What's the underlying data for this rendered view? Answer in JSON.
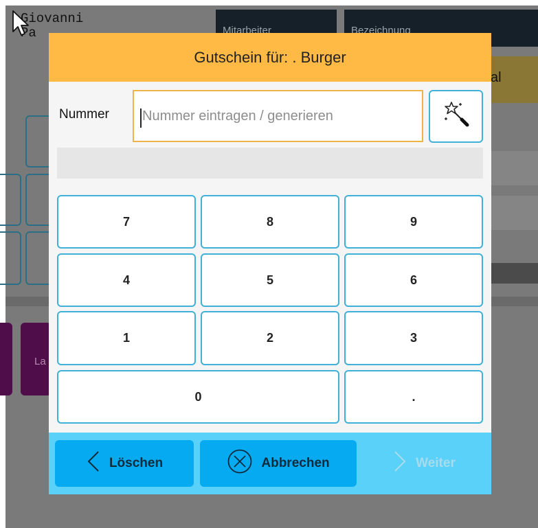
{
  "background": {
    "user_line1": "Giovanni",
    "user_line2": "Pa",
    "header_col1": "Mitarbeiter",
    "header_col2": "Bezeichnung",
    "gold_button_fragment": "al",
    "purple_button_fragment": "La"
  },
  "dialog": {
    "title": "Gutschein für: . Burger",
    "number_label": "Nummer",
    "number_placeholder": "Nummer eintragen / generieren",
    "number_value": "",
    "wand_icon": "magic-wand-icon",
    "keypad": {
      "k7": "7",
      "k8": "8",
      "k9": "9",
      "k4": "4",
      "k5": "5",
      "k6": "6",
      "k1": "1",
      "k2": "2",
      "k3": "3",
      "k0": "0",
      "kdot": "."
    },
    "footer": {
      "delete_label": "Löschen",
      "cancel_label": "Abbrechen",
      "next_label": "Weiter"
    }
  },
  "colors": {
    "title_bar": "#ffba45",
    "input_border": "#f0b34a",
    "key_border": "#41b0d6",
    "footer_bg": "#5ad1f9",
    "footer_button": "#06aaf1"
  }
}
